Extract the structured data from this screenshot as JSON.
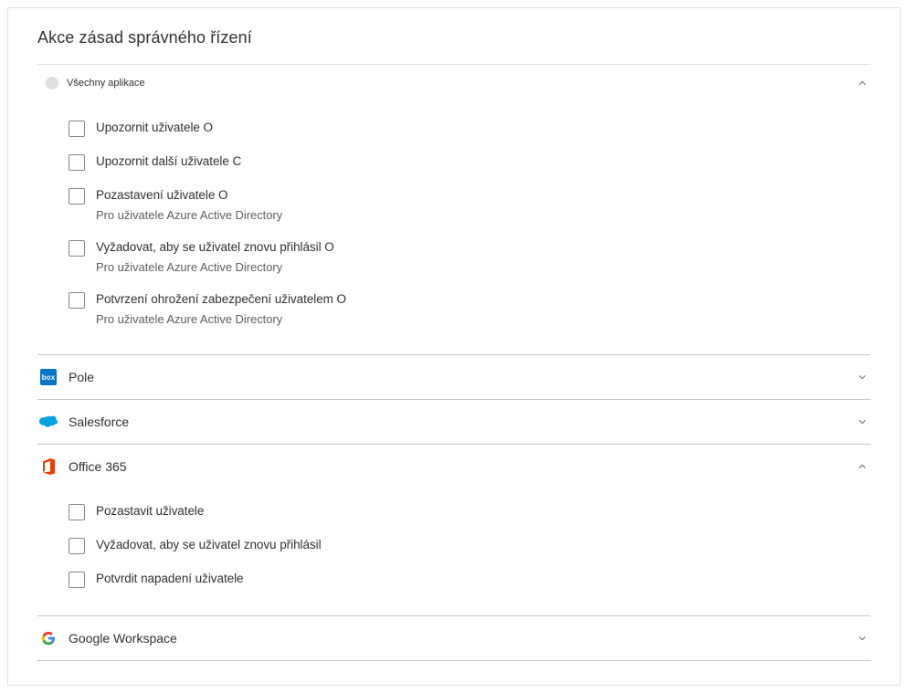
{
  "title": "Akce zásad správného řízení",
  "sections": {
    "all_apps": {
      "title": "Všechny aplikace",
      "expanded": true,
      "actions": [
        {
          "label": "Upozornit uživatele O",
          "sub": ""
        },
        {
          "label": "Upozornit další uživatele C",
          "sub": ""
        },
        {
          "label": "Pozastavení uživatele O",
          "sub": "Pro uživatele Azure Active Directory"
        },
        {
          "label": "Vyžadovat, aby se uživatel znovu přihlásil O",
          "sub": "Pro uživatele Azure Active Directory"
        },
        {
          "label": "Potvrzení ohrožení zabezpečení uživatelem O",
          "sub": "Pro uživatele Azure Active Directory"
        }
      ]
    },
    "box": {
      "title": "Pole",
      "expanded": false
    },
    "salesforce": {
      "title": "Salesforce",
      "expanded": false
    },
    "office365": {
      "title": "Office 365",
      "expanded": true,
      "actions": [
        {
          "label": "Pozastavit uživatele",
          "sub": ""
        },
        {
          "label": "Vyžadovat, aby se uživatel znovu přihlásil",
          "sub": ""
        },
        {
          "label": "Potvrdit napadení uživatele",
          "sub": ""
        }
      ]
    },
    "google": {
      "title": "Google Workspace",
      "expanded": false
    }
  }
}
